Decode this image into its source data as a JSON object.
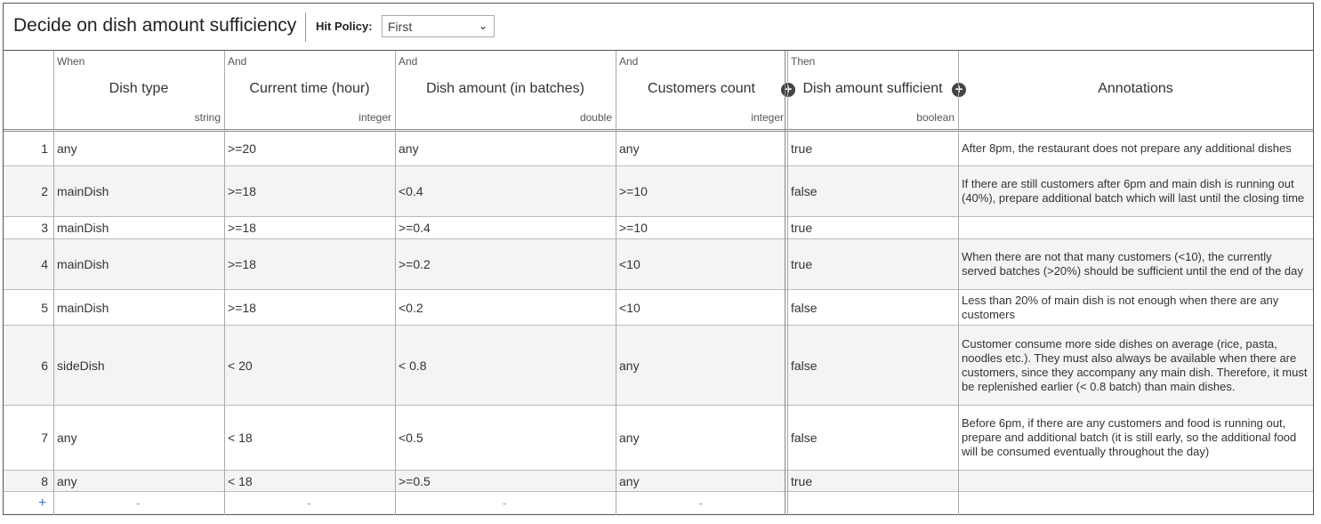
{
  "title": "Decide on dish amount sufficiency",
  "hit_policy": {
    "label": "Hit Policy:",
    "value": "First"
  },
  "columns": [
    {
      "kind": "When",
      "name": "Dish type",
      "type": "string"
    },
    {
      "kind": "And",
      "name": "Current time (hour)",
      "type": "integer"
    },
    {
      "kind": "And",
      "name": "Dish amount (in batches)",
      "type": "double"
    },
    {
      "kind": "And",
      "name": "Customers count",
      "type": "integer"
    },
    {
      "kind": "Then",
      "name": "Dish amount sufficient",
      "type": "boolean"
    },
    {
      "kind": "",
      "name": "Annotations",
      "type": ""
    }
  ],
  "rows": [
    {
      "n": "1",
      "c": [
        "any",
        ">=20",
        "any",
        "any",
        "true"
      ],
      "ann": "After 8pm, the restaurant does not prepare any additional dishes"
    },
    {
      "n": "2",
      "c": [
        "mainDish",
        ">=18",
        "<0.4",
        ">=10",
        "false"
      ],
      "ann": "If there are still customers after 6pm and main dish is running out (40%), prepare additional batch which will last until the closing time"
    },
    {
      "n": "3",
      "c": [
        "mainDish",
        ">=18",
        ">=0.4",
        ">=10",
        "true"
      ],
      "ann": ""
    },
    {
      "n": "4",
      "c": [
        "mainDish",
        ">=18",
        ">=0.2",
        "<10",
        "true"
      ],
      "ann": "When there are not that many customers (<10), the currently served batches (>20%) should be sufficient until the end of the day"
    },
    {
      "n": "5",
      "c": [
        "mainDish",
        ">=18",
        "<0.2",
        "<10",
        "false"
      ],
      "ann": "Less than 20% of main dish is not enough when there are any customers"
    },
    {
      "n": "6",
      "c": [
        "sideDish",
        "< 20",
        "< 0.8",
        "any",
        "false"
      ],
      "ann": "Customer consume more side dishes on average (rice, pasta, noodles etc.). They must also always be available when there are customers, since they accompany any main dish. Therefore, it must be replenished earlier (< 0.8 batch) than main dishes."
    },
    {
      "n": "7",
      "c": [
        "any",
        "< 18",
        "<0.5",
        "any",
        "false"
      ],
      "ann": "Before 6pm, if there are any customers and food is running out, prepare and additional batch (it is still early, so the additional food will be consumed eventually throughout the day)"
    },
    {
      "n": "8",
      "c": [
        "any",
        "< 18",
        ">=0.5",
        "any",
        "true"
      ],
      "ann": ""
    }
  ],
  "add_row": {
    "plus": "+",
    "dash": "-"
  },
  "add_column_icon": "plus-circle-icon"
}
